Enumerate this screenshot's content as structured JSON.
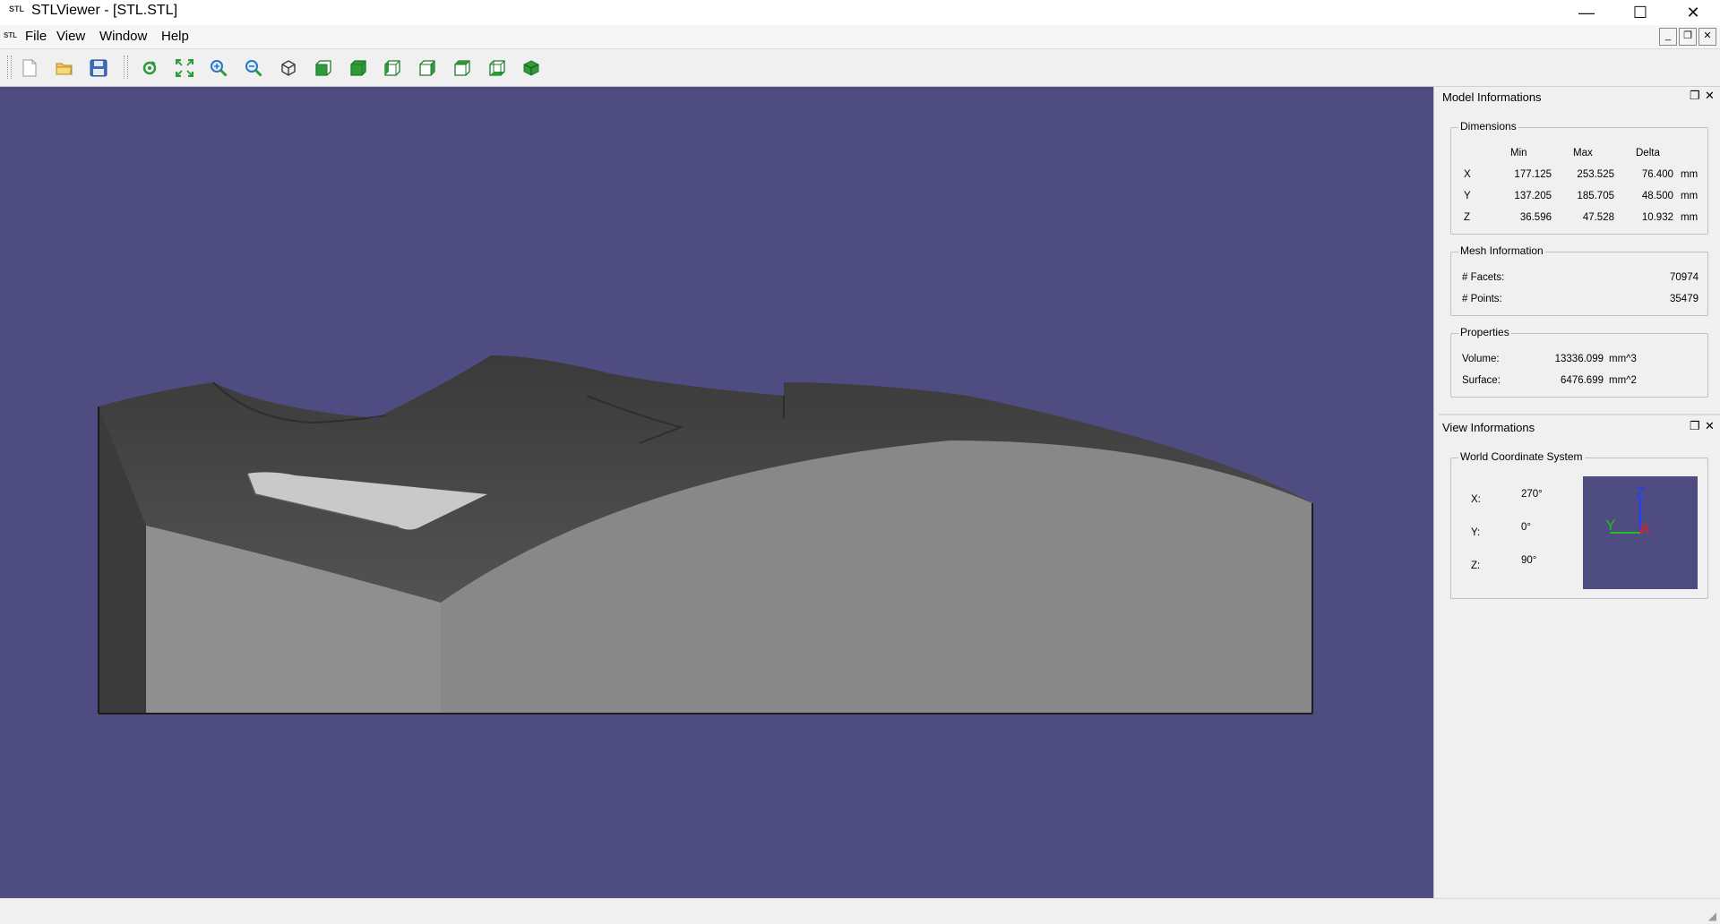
{
  "window": {
    "title": "STLViewer - [STL.STL]",
    "app_icon_text": "STL",
    "minimize_glyph": "—",
    "maximize_glyph": "☐",
    "close_glyph": "✕"
  },
  "menubar": {
    "items": [
      "File",
      "View",
      "Window",
      "Help"
    ],
    "mdi_minimize": "_",
    "mdi_restore": "❐",
    "mdi_close": "✕"
  },
  "toolbar": {
    "buttons": [
      "new-file-icon",
      "open-folder-icon",
      "save-icon",
      "rotate-icon",
      "fit-all-icon",
      "zoom-in-icon",
      "zoom-out-icon",
      "iso-view-icon",
      "front-view-icon",
      "back-view-icon",
      "left-view-icon",
      "right-view-icon",
      "top-view-icon",
      "bottom-view-icon",
      "shaded-view-icon"
    ]
  },
  "viewport": {
    "background": "#4e4c80"
  },
  "model_info": {
    "title": "Model Informations",
    "dimensions": {
      "label": "Dimensions",
      "headers": [
        "Min",
        "Max",
        "Delta"
      ],
      "rows": [
        {
          "axis": "X",
          "min": "177.125",
          "max": "253.525",
          "delta": "76.400",
          "unit": "mm"
        },
        {
          "axis": "Y",
          "min": "137.205",
          "max": "185.705",
          "delta": "48.500",
          "unit": "mm"
        },
        {
          "axis": "Z",
          "min": "36.596",
          "max": "47.528",
          "delta": "10.932",
          "unit": "mm"
        }
      ]
    },
    "mesh": {
      "label": "Mesh Information",
      "facets_label": "# Facets:",
      "facets": "70974",
      "points_label": "# Points:",
      "points": "35479"
    },
    "properties": {
      "label": "Properties",
      "volume_label": "Volume:",
      "volume": "13336.099",
      "volume_unit": "mm^3",
      "surface_label": "Surface:",
      "surface": "6476.699",
      "surface_unit": "mm^2"
    }
  },
  "view_info": {
    "title": "View Informations",
    "wcs": {
      "label": "World Coordinate System",
      "x_label": "X:",
      "x": "270°",
      "y_label": "Y:",
      "y": "0°",
      "z_label": "Z:",
      "z": "90°"
    },
    "axes": {
      "x": "X",
      "y": "Y",
      "z": "Z"
    }
  },
  "colors": {
    "viewport_bg": "#4e4c80",
    "axis_x": "#e02020",
    "axis_y": "#20c020",
    "axis_z": "#2040ff"
  }
}
